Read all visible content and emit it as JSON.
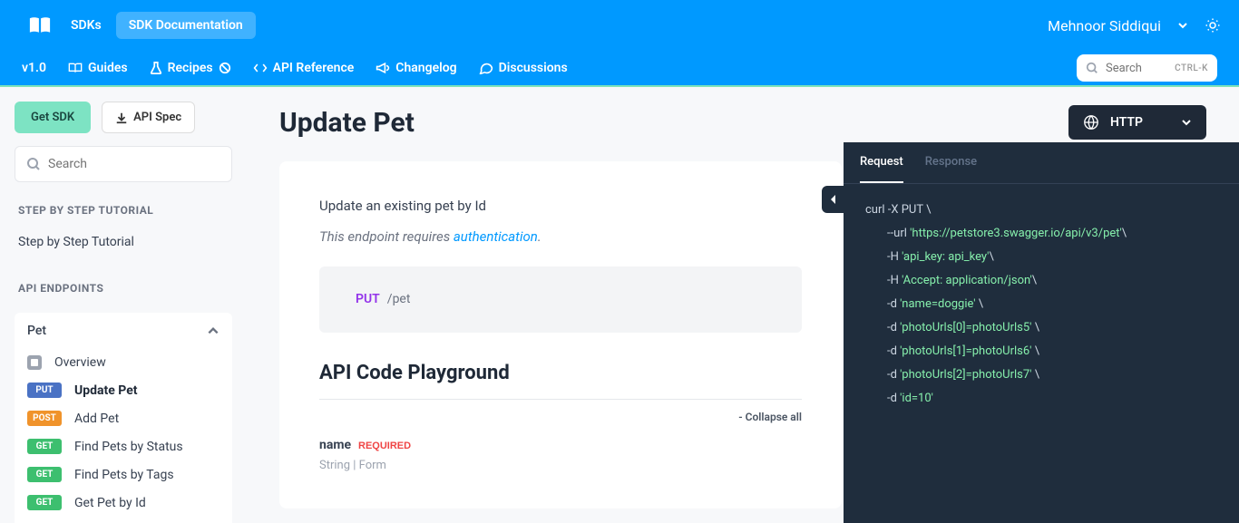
{
  "header": {
    "sdks": "SDKs",
    "sdk_doc": "SDK Documentation",
    "user": "Mehnoor Siddiqui"
  },
  "nav": {
    "version": "v1.0",
    "guides": "Guides",
    "recipes": "Recipes",
    "api_ref": "API Reference",
    "changelog": "Changelog",
    "discussions": "Discussions",
    "search_placeholder": "Search",
    "search_shortcut": "CTRL-K"
  },
  "sidebar": {
    "get_sdk": "Get SDK",
    "api_spec": "API Spec",
    "search_placeholder": "Search",
    "section1_label": "STEP BY STEP TUTORIAL",
    "tutorial_link": "Step by Step Tutorial",
    "section2_label": "API ENDPOINTS",
    "group_pet": "Pet",
    "items": [
      {
        "method": "",
        "label": "Overview",
        "cls": ""
      },
      {
        "method": "PUT",
        "label": "Update Pet",
        "cls": "method-put"
      },
      {
        "method": "POST",
        "label": "Add Pet",
        "cls": "method-post"
      },
      {
        "method": "GET",
        "label": "Find Pets by Status",
        "cls": "method-get"
      },
      {
        "method": "GET",
        "label": "Find Pets by Tags",
        "cls": "method-get"
      },
      {
        "method": "GET",
        "label": "Get Pet by Id",
        "cls": "method-get"
      }
    ]
  },
  "content": {
    "title": "Update Pet",
    "http_label": "HTTP",
    "description": "Update an existing pet by Id",
    "auth_prefix": "This endpoint requires ",
    "auth_link": "authentication",
    "method_verb": "PUT",
    "method_path": "/pet",
    "playground_title": "API Code Playground",
    "collapse_all": "- Collapse all",
    "param_name": "name",
    "param_required": "REQUIRED",
    "param_type": "String",
    "param_loc": "Form"
  },
  "code": {
    "tab_request": "Request",
    "tab_response": "Response",
    "lines": [
      {
        "t1": "curl -X PUT ",
        "t2": "\\"
      },
      {
        "pad": 1,
        "t1": "--url ",
        "s": "'https://petstore3.swagger.io/api/v3/pet'",
        "t2": "\\"
      },
      {
        "pad": 1,
        "t1": "-H ",
        "s": "'api_key: api_key'",
        "t2": "\\"
      },
      {
        "pad": 1,
        "t1": "-H ",
        "s": "'Accept: application/json'",
        "t2": "\\"
      },
      {
        "pad": 1,
        "t1": "-d ",
        "s": "'name=doggie'",
        "t2": " \\"
      },
      {
        "pad": 1,
        "t1": "-d ",
        "s": "'photoUrls[0]=photoUrls5'",
        "t2": " \\"
      },
      {
        "pad": 1,
        "t1": "-d ",
        "s": "'photoUrls[1]=photoUrls6'",
        "t2": " \\"
      },
      {
        "pad": 1,
        "t1": "-d ",
        "s": "'photoUrls[2]=photoUrls7'",
        "t2": " \\"
      },
      {
        "pad": 1,
        "t1": "-d ",
        "s": "'id=10'",
        "t2": ""
      }
    ]
  }
}
